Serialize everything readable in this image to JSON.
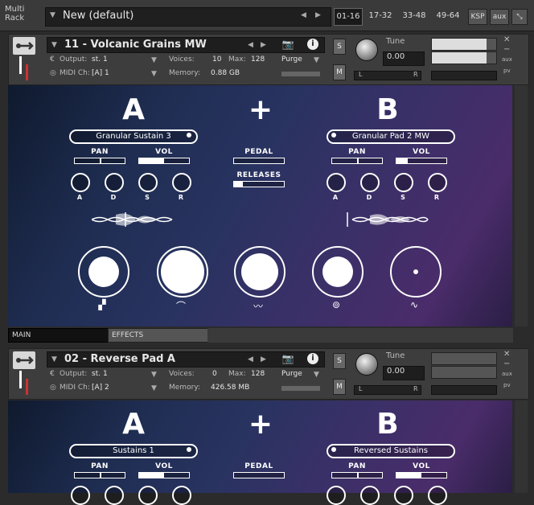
{
  "multirack": {
    "label": "Multi\nRack",
    "title": "New (default)",
    "ranges": [
      "01-16",
      "17-32",
      "33-48",
      "49-64"
    ],
    "active_range": "01-16",
    "ksp_label": "KSP",
    "aux_label": "aux"
  },
  "instruments": [
    {
      "name": "11 - Volcanic Grains MW",
      "output_label": "Output:",
      "output": "st. 1",
      "voices_label": "Voices:",
      "voices": "10",
      "max_label": "Max:",
      "max": "128",
      "purge_label": "Purge",
      "midi_label": "MIDI Ch:",
      "midi": "[A]  1",
      "memory_label": "Memory:",
      "memory": "0.88 GB",
      "s_label": "S",
      "m_label": "M",
      "tune_label": "Tune",
      "tune_value": "0.00",
      "pan_l": "L",
      "pan_r": "R",
      "aux_label": "aux",
      "pv_label": "pv",
      "panel": {
        "a_letter": "A",
        "plus": "+",
        "b_letter": "B",
        "a_preset": "Granular Sustain 3",
        "b_preset": "Granular Pad 2 MW",
        "pan_label": "PAN",
        "vol_label": "VOL",
        "pedal_label": "PEDAL",
        "releases_label": "RELEASES",
        "adsr": [
          "A",
          "D",
          "S",
          "R"
        ],
        "a_vol_level": 0.5,
        "b_vol_level": 0.22,
        "releases_level": 0.18
      }
    },
    {
      "name": "02 - Reverse Pad A",
      "output_label": "Output:",
      "output": "st. 1",
      "voices_label": "Voices:",
      "voices": "0",
      "max_label": "Max:",
      "max": "128",
      "purge_label": "Purge",
      "midi_label": "MIDI Ch:",
      "midi": "[A]  2",
      "memory_label": "Memory:",
      "memory": "426.58 MB",
      "s_label": "S",
      "m_label": "M",
      "tune_label": "Tune",
      "tune_value": "0.00",
      "pan_l": "L",
      "pan_r": "R",
      "aux_label": "aux",
      "pv_label": "pv",
      "panel": {
        "a_letter": "A",
        "plus": "+",
        "b_letter": "B",
        "a_preset": "Sustains 1",
        "b_preset": "Reversed Sustains",
        "pan_label": "PAN",
        "vol_label": "VOL",
        "pedal_label": "PEDAL",
        "a_vol_level": 0.5,
        "b_vol_level": 0.5
      }
    }
  ],
  "tabs": {
    "main": "MAIN",
    "effects": "EFFECTS"
  }
}
